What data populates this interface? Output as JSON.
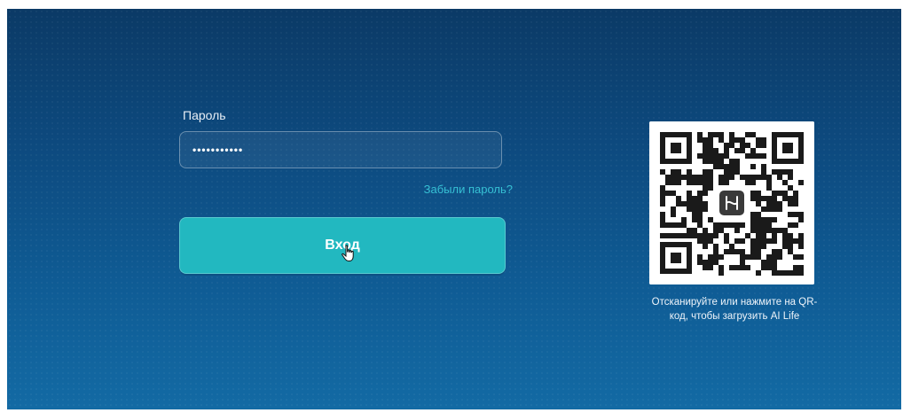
{
  "login": {
    "password_label": "Пароль",
    "password_mask": "•••••••••••",
    "forgot_password": "Забыли пароль?",
    "login_button": "Вход"
  },
  "qr": {
    "caption_line1": "Отсканируйте или нажмите на QR-",
    "caption_line2": "код, чтобы загрузить AI Life",
    "center_logo": "app-logo-icon"
  },
  "colors": {
    "accent": "#22b8c0",
    "link": "#36c0d4",
    "background": "#0d4a7f"
  }
}
